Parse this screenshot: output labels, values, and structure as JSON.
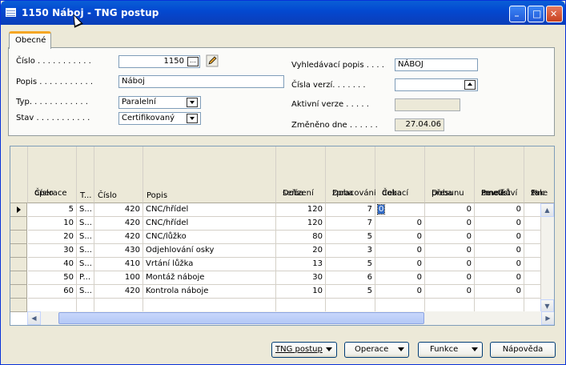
{
  "window": {
    "title": "1150 Náboj - TNG postup",
    "min_label": "_",
    "max_label": "□",
    "close_label": "✕"
  },
  "tabs": [
    {
      "label": "Obecné"
    }
  ],
  "general": {
    "cislo_label": "Číslo . . . . . . . . . . .",
    "cislo_value": "1150",
    "cislo_lookup": "…",
    "popis_label": "Popis . . . . . . . . . . .",
    "popis_value": "Náboj",
    "typ_label": "Typ. . . . . . . . . . . .",
    "typ_value": "Paralelní",
    "stav_label": "Stav . . . . . . . . . . .",
    "stav_value": "Certifikovaný",
    "vyhled_label": "Vyhledávací popis . . . .",
    "vyhled_value": "NÁBOJ",
    "verze_label": "Čísla verzí. . . . . . .",
    "verze_value": "",
    "aktivni_label": "Aktivní verze . . . . .",
    "aktivni_value": "",
    "zmeneno_label": "Změněno dne . . . . . .",
    "zmeneno_value": "27.04.06"
  },
  "grid": {
    "headers": [
      {
        "l1": "Číslo",
        "l2": "operace"
      },
      {
        "l1": "",
        "l2": "T..."
      },
      {
        "l1": "",
        "l2": "Číslo"
      },
      {
        "l1": "",
        "l2": "Popis"
      },
      {
        "l1": "Doba",
        "l2": "seřízení"
      },
      {
        "l1": "Doba",
        "l2": "zpracování"
      },
      {
        "l1": "Čekací",
        "l2": "doba"
      },
      {
        "l1": "Doba",
        "l2": "přesunu"
      },
      {
        "l1": "Pevné",
        "l1b": "množství",
        "l2": "zmetků"
      },
      {
        "l1": "Fak",
        "l1b": "zme",
        "l2": "%"
      }
    ],
    "rows": [
      {
        "op": "5",
        "t": "S...",
        "num": "420",
        "desc": "CNC/hřídel",
        "setup": "120",
        "proc": "7",
        "wait": "0",
        "move": "0",
        "scrap": "0"
      },
      {
        "op": "10",
        "t": "S...",
        "num": "420",
        "desc": "CNC/hřídel",
        "setup": "120",
        "proc": "7",
        "wait": "0",
        "move": "0",
        "scrap": "0"
      },
      {
        "op": "20",
        "t": "S...",
        "num": "420",
        "desc": "CNC/lůžko",
        "setup": "80",
        "proc": "5",
        "wait": "0",
        "move": "0",
        "scrap": "0"
      },
      {
        "op": "30",
        "t": "S...",
        "num": "430",
        "desc": "Odjehlování osky",
        "setup": "20",
        "proc": "3",
        "wait": "0",
        "move": "0",
        "scrap": "0"
      },
      {
        "op": "40",
        "t": "S...",
        "num": "410",
        "desc": "Vrtání lůžka",
        "setup": "13",
        "proc": "5",
        "wait": "0",
        "move": "0",
        "scrap": "0"
      },
      {
        "op": "50",
        "t": "P...",
        "num": "100",
        "desc": "Montáž náboje",
        "setup": "30",
        "proc": "6",
        "wait": "0",
        "move": "0",
        "scrap": "0"
      },
      {
        "op": "60",
        "t": "S...",
        "num": "420",
        "desc": "Kontrola náboje",
        "setup": "10",
        "proc": "5",
        "wait": "0",
        "move": "0",
        "scrap": "0"
      }
    ]
  },
  "buttons": {
    "tng": "TNG postup",
    "operace": "Operace",
    "funkce": "Funkce",
    "napoveda": "Nápověda"
  }
}
